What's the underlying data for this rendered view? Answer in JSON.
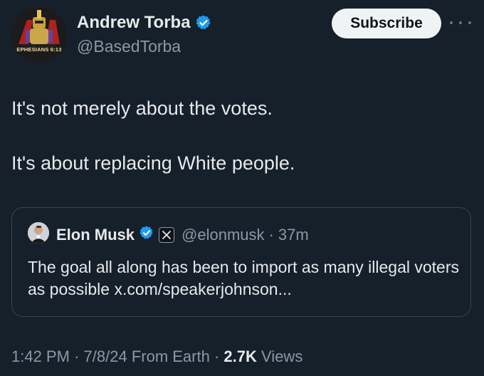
{
  "author": {
    "name": "Andrew Torba",
    "handle": "@BasedTorba",
    "avatar_caption": "EPHESIANS 6:13",
    "verified_icon": "verified-badge-icon"
  },
  "header": {
    "subscribe_label": "Subscribe",
    "more_icon": "more-options-icon"
  },
  "tweet": {
    "line1": "It's not merely about the votes.",
    "line2": "It's about replacing White people."
  },
  "quoted_tweet": {
    "name": "Elon Musk",
    "handle": "@elonmusk",
    "separator": "·",
    "time": "37m",
    "text": "The goal all along has been to import as many illegal voters as possible x.com/speakerjohnson..."
  },
  "meta": {
    "time": "1:42 PM",
    "date": "7/8/24",
    "source": "From Earth",
    "views_count": "2.7K",
    "views_label": "Views",
    "sep": "·"
  },
  "colors": {
    "background": "#15202b",
    "primary_text": "#e7e9ea",
    "secondary_text": "#8b98a5",
    "verified": "#1d9bf0",
    "border": "#38444d"
  }
}
